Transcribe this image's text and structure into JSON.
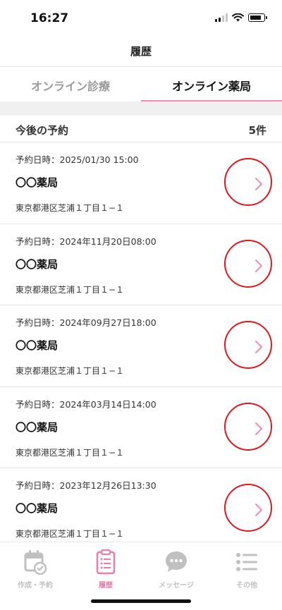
{
  "status": {
    "time": "16:27"
  },
  "header": {
    "title": "履歴"
  },
  "tabs": [
    {
      "label": "オンライン診療",
      "active": false
    },
    {
      "label": "オンライン薬局",
      "active": true
    }
  ],
  "section": {
    "title": "今後の予約",
    "count": "5件"
  },
  "reservations": [
    {
      "datetime": "予約日時：2025/01/30  15:00",
      "name": "〇〇薬局",
      "address": "東京都港区芝浦１丁目１−１"
    },
    {
      "datetime": "予約日時：2024年11月20日08:00",
      "name": "〇〇薬局",
      "address": "東京都港区芝浦１丁目１−１"
    },
    {
      "datetime": "予約日時：2024年09月27日18:00",
      "name": "〇〇薬局",
      "address": "東京都港区芝浦１丁目１−１"
    },
    {
      "datetime": "予約日時：2024年03月14日14:00",
      "name": "〇〇薬局",
      "address": "東京都港区芝浦１丁目１−１"
    },
    {
      "datetime": "予約日時：2023年12月26日13:30",
      "name": "〇〇薬局",
      "address": "東京都港区芝浦１丁目１−１"
    }
  ],
  "tabbar": [
    {
      "label": "作成・予約",
      "icon": "calendar-check-icon",
      "active": false
    },
    {
      "label": "履歴",
      "icon": "clipboard-list-icon",
      "active": true
    },
    {
      "label": "メッセージ",
      "icon": "chat-bubble-icon",
      "active": false
    },
    {
      "label": "その他",
      "icon": "menu-list-icon",
      "active": false
    }
  ],
  "colors": {
    "accent": "#f28cb1",
    "annotation": "#e0161c",
    "inactive": "#c0c0c0"
  }
}
